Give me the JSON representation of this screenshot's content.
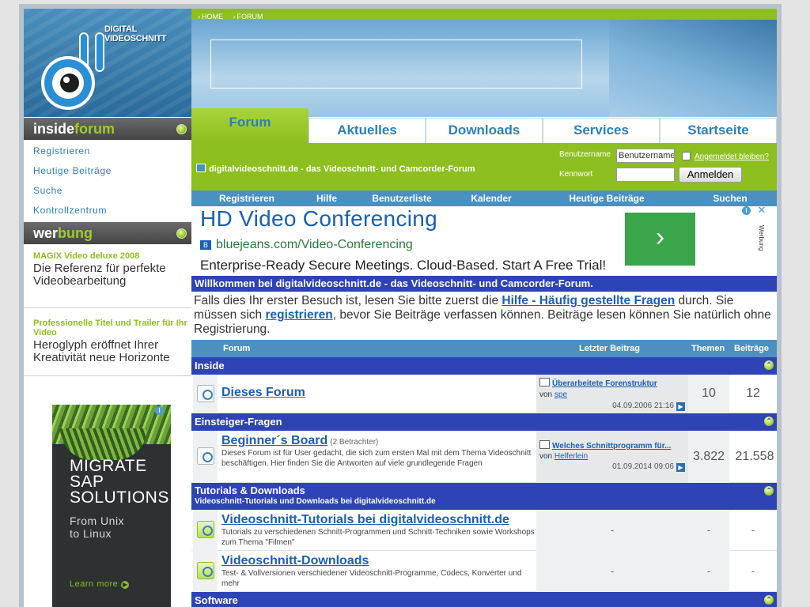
{
  "breadcrumb": [
    "HOME",
    "FORUM"
  ],
  "logo": {
    "line1": "DIGITAL",
    "line2": "VIDEOSCHNITT"
  },
  "tabs": [
    "Forum",
    "Aktuelles",
    "Downloads",
    "Services",
    "Startseite"
  ],
  "sidebar": {
    "inside_head": {
      "w": "inside",
      "g": "forum"
    },
    "links": [
      "Registrieren",
      "Heutige Beiträge",
      "Suche",
      "Kontrollzentrum"
    ],
    "werbung_head": {
      "w": "wer",
      "g": "bung"
    },
    "promos": [
      {
        "title": "MAGIX Video deluxe 2008",
        "desc": "Die Referenz für perfekte Videobearbeitung"
      },
      {
        "title": "Professionelle Titel und Trailer für Ihr Video",
        "desc": "Heroglyph eröffnet Ihrer Kreativität neue Horizonte"
      }
    ],
    "ad": {
      "big1": "MIGRATE",
      "big2": "SAP",
      "big3": "SOLUTIONS",
      "small1": "From Unix",
      "small2": "to Linux",
      "more": "Learn more"
    }
  },
  "forumbar": {
    "title": "digitalvideoschnitt.de - das Videoschnitt- und Camcorder-Forum",
    "user_label": "Benutzername",
    "user_value": "Benutzername",
    "remember_label": "Angemeldet bleiben?",
    "pass_label": "Kennwort",
    "login_button": "Anmelden"
  },
  "subnav": [
    "Registrieren",
    "Hilfe",
    "Benutzerliste",
    "Kalender",
    "Heutige Beiträge",
    "Suchen"
  ],
  "ad": {
    "headline": "HD Video Conferencing",
    "url": "bluejeans.com/Video-Conferencing",
    "desc": "Enterprise-Ready Secure Meetings. Cloud-Based. Start A Free Trial!",
    "side": "Werbung"
  },
  "welcome": {
    "title": "Willkommen bei digitalvideoschnitt.de - das Videoschnitt- und Camcorder-Forum.",
    "t1": "Falls dies Ihr erster Besuch ist, lesen Sie bitte zuerst die ",
    "link1": "Hilfe - Häufig gestellte Fragen",
    "t2": " durch. Sie müssen sich ",
    "link2": "registrieren",
    "t3": ", bevor Sie Beiträge verfassen können. Beiträge lesen können Sie natürlich ohne Registrierung."
  },
  "table_header": {
    "forum": "Forum",
    "last": "Letzter Beitrag",
    "themen": "Themen",
    "beitraege": "Beiträge"
  },
  "categories": [
    {
      "name": "Inside"
    },
    {
      "name": "Einsteiger-Fragen"
    },
    {
      "name": "Tutorials & Downloads",
      "sub": "Videoschnitt-Tutorials und Downloads bei digitalvideoschnitt.de"
    },
    {
      "name": "Software"
    }
  ],
  "forums": [
    {
      "name": "Dieses Forum",
      "viewers": "",
      "desc": "",
      "last_title": "Überarbeitete Forenstruktur",
      "last_by": "von",
      "last_user": "spe",
      "last_date": "04.09.2006",
      "last_time": "21:16",
      "themen": "10",
      "beitraege": "12"
    },
    {
      "name": "Beginner´s Board",
      "viewers": "(2 Betrachter)",
      "desc": "Dieses Forum ist für User gedacht, die sich zum ersten Mal mit dem Thema Videoschnitt beschäftigen. Hier finden Sie die Antworten auf viele grundlegende Fragen",
      "last_title": "Welches Schnittprogramm für...",
      "last_by": "von",
      "last_user": "Helferlein",
      "last_date": "01.09.2014",
      "last_time": "09:06",
      "themen": "3.822",
      "beitraege": "21.558"
    },
    {
      "name": "Videoschnitt-Tutorials bei digitalvideoschnitt.de",
      "viewers": "",
      "desc": "Tutorials zu verschiedenen Schnitt-Programmen und Schnitt-Techniken sowie Workshops zum Thema \"Filmen\"",
      "last": "-",
      "themen": "-",
      "beitraege": "-"
    },
    {
      "name": "Videoschnitt-Downloads",
      "viewers": "",
      "desc": "Test- & Vollversionen verschiedener Videoschnitt-Programme, Codecs, Konverter und mehr",
      "last": "-",
      "themen": "-",
      "beitraege": "-"
    }
  ]
}
